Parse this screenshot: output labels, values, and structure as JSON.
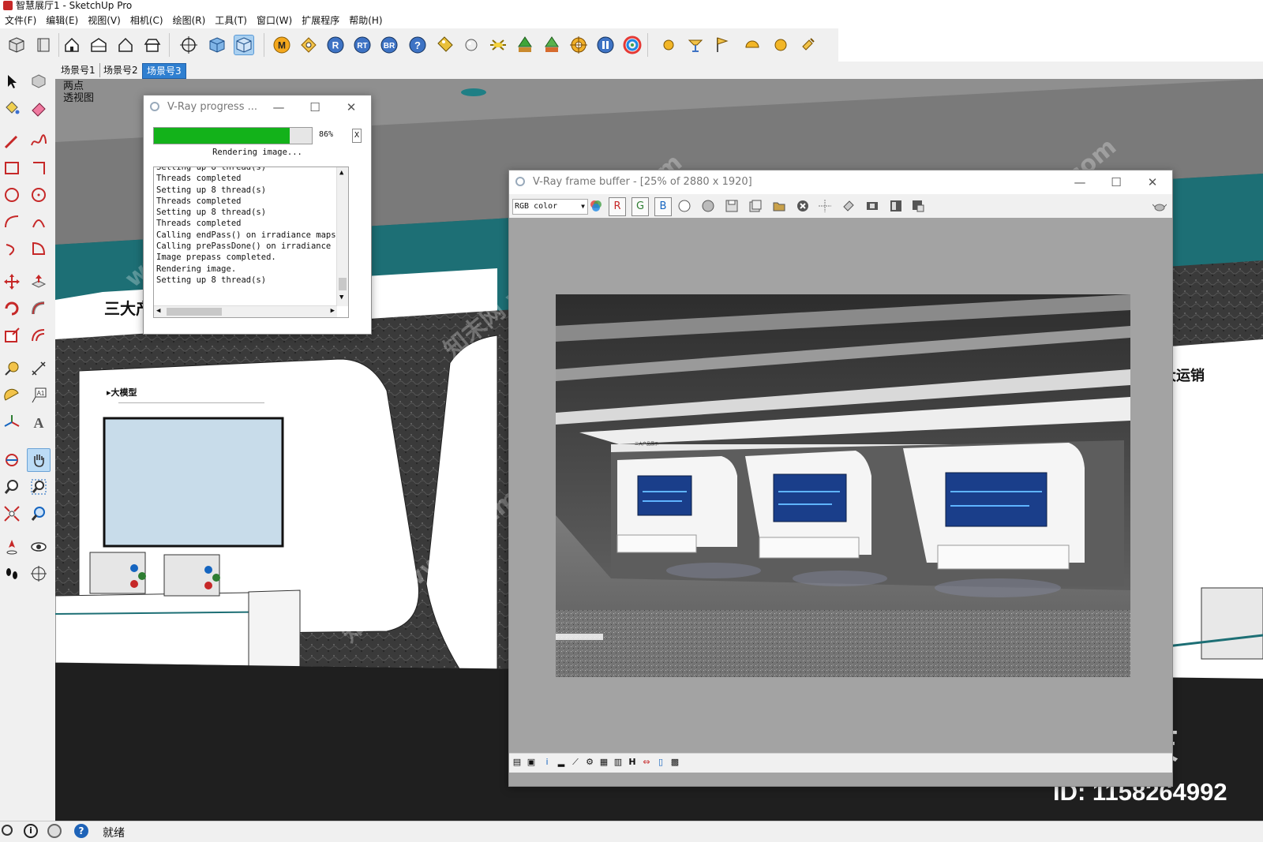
{
  "app": {
    "window_title": "智慧展厅1 - SketchUp Pro"
  },
  "menu": [
    "文件(F)",
    "编辑(E)",
    "视图(V)",
    "相机(C)",
    "绘图(R)",
    "工具(T)",
    "窗口(W)",
    "扩展程序",
    "帮助(H)"
  ],
  "toolbar_icons": [
    "cube-icon",
    "book-icon",
    "home-icon",
    "warehouse-icon",
    "house-outline-icon",
    "roof-icon",
    "orbit-target-icon",
    "cube-blue-icon",
    "cube-active-icon",
    "vray-m-icon",
    "vray-material-icon",
    "vray-r-icon",
    "vray-rt-icon",
    "vray-br-icon",
    "help-icon",
    "tag-icon",
    "sphere-icon",
    "light-icon",
    "tree-icon",
    "tree2-icon",
    "sun-icon",
    "pause-icon",
    "color-wheel-icon",
    "orb-icon",
    "lamp-icon",
    "flag-icon",
    "dome-icon",
    "ball-icon",
    "bulb-icon"
  ],
  "scene_tabs": [
    "场景号1",
    "场景号2",
    "场景号3"
  ],
  "selected_tab_index": 2,
  "viewport": {
    "view_label_line1": "两点",
    "view_label_line2": "透视图",
    "wall_text_left": "三大产",
    "panel_heading": "▸大模型",
    "wall_text_right": "大运销",
    "watermark_brand": "知末",
    "id_text": "ID: 1158264992"
  },
  "vray_progress": {
    "title": "V-Ray progress ...",
    "percent_label": "86%",
    "percent": 86,
    "cancel_label": "X",
    "status": "Rendering image...",
    "log_lines": [
      "Setting up 8 thread(s)",
      "Threads completed",
      "Setting up 8 thread(s)",
      "Threads completed",
      "Setting up 8 thread(s)",
      "Threads completed",
      "Calling endPass() on irradiance maps",
      "Calling prePassDone() on irradiance map",
      "Image prepass completed.",
      "Rendering image.",
      "Setting up 8 thread(s)"
    ]
  },
  "vray_frame_buffer": {
    "title": "V-Ray frame buffer - [25% of 2880 x 1920]",
    "channel_select": "RGB color",
    "channel_buttons": [
      "R",
      "G",
      "B"
    ],
    "render_caption": "三大产品展示"
  },
  "status": {
    "text": "就绪"
  },
  "colors": {
    "progress_green": "#13b21a",
    "tab_selected": "#2f7fd0",
    "teal_accent": "#1d6f75"
  }
}
